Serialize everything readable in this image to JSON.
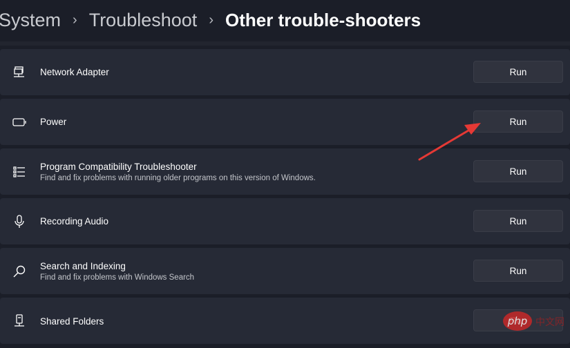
{
  "breadcrumb": {
    "items": [
      "System",
      "Troubleshoot"
    ],
    "current": "Other trouble-shooters",
    "separator": "›"
  },
  "rows": [
    {
      "title": "Network Adapter",
      "subtitle": "",
      "icon": "network-adapter-icon",
      "button": "Run"
    },
    {
      "title": "Power",
      "subtitle": "",
      "icon": "battery-icon",
      "button": "Run"
    },
    {
      "title": "Program Compatibility Troubleshooter",
      "subtitle": "Find and fix problems with running older programs on this version of Windows.",
      "icon": "list-icon",
      "button": "Run"
    },
    {
      "title": "Recording Audio",
      "subtitle": "",
      "icon": "microphone-icon",
      "button": "Run"
    },
    {
      "title": "Search and Indexing",
      "subtitle": "Find and fix problems with Windows Search",
      "icon": "search-icon",
      "button": "Run"
    },
    {
      "title": "Shared Folders",
      "subtitle": "",
      "icon": "shared-folder-icon",
      "button": "Run"
    }
  ],
  "annotation": {
    "arrow_color": "#e53935"
  },
  "watermark": {
    "text": "php 中文网"
  }
}
